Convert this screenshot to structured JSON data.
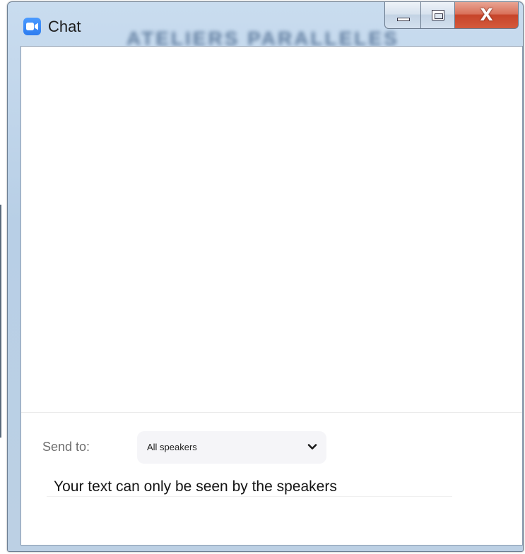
{
  "window": {
    "title": "Chat",
    "background_caption": "ATELIERS PARALLELES",
    "controls": {
      "minimize_icon": "minimize-icon",
      "maximize_icon": "restore-icon",
      "close_glyph": "X"
    },
    "app_icon": "zoom-camera-icon"
  },
  "composer": {
    "send_to_label": "Send to:",
    "recipient_selected": "All speakers",
    "dropdown_icon": "chevron-down-icon",
    "hint_text": "Your text can only be seen by the speakers"
  },
  "colors": {
    "app_icon_blue": "#2d7cf0",
    "close_button_red": "#c7442a",
    "dropdown_bg": "#f5f5f8"
  }
}
